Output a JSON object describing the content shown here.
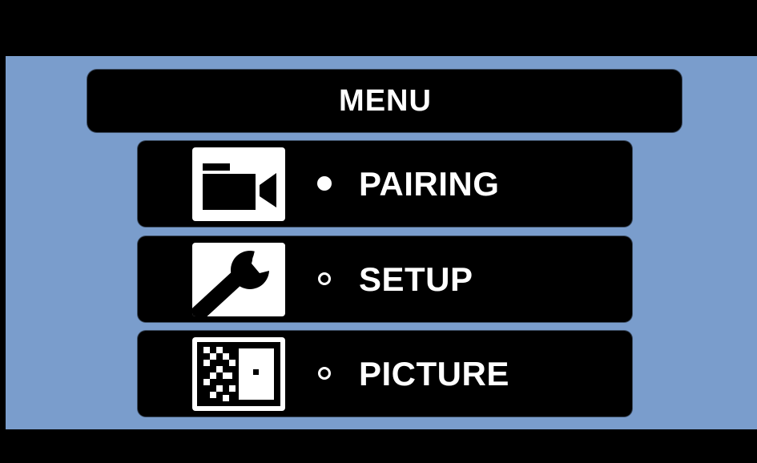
{
  "menu": {
    "title": "MENU",
    "items": [
      {
        "label": "PAIRING",
        "icon": "video-camera-icon",
        "selected": true
      },
      {
        "label": "SETUP",
        "icon": "wrench-icon",
        "selected": false
      },
      {
        "label": "PICTURE",
        "icon": "picture-pattern-icon",
        "selected": false
      }
    ]
  },
  "colors": {
    "panel_background": "#7a9dcc",
    "bars": "#000000",
    "text": "#ffffff"
  }
}
